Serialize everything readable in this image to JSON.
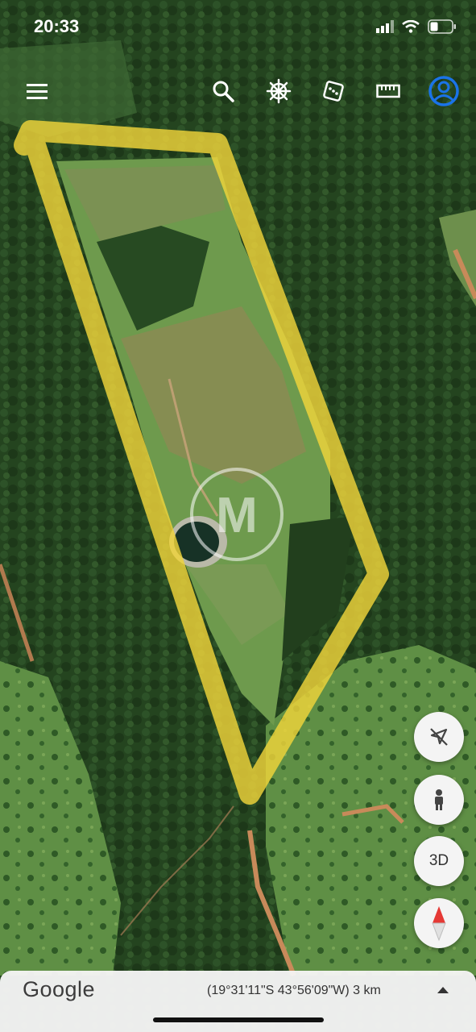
{
  "status_bar": {
    "time": "20:33"
  },
  "toolbar": {
    "icons": [
      "menu-icon",
      "search-icon",
      "voyager-wheel-icon",
      "dice-icon",
      "ruler-icon",
      "account-icon"
    ]
  },
  "map": {
    "type": "satellite",
    "outline_color": "#f0d43a",
    "watermark": "M"
  },
  "controls": {
    "threeD_label": "3D"
  },
  "bottom_bar": {
    "logo": "Google",
    "coordinates": "(19°31'11\"S 43°56'09\"W) 3 km"
  },
  "colors": {
    "accent_blue": "#1a73e8",
    "compass_red": "#e53935"
  }
}
